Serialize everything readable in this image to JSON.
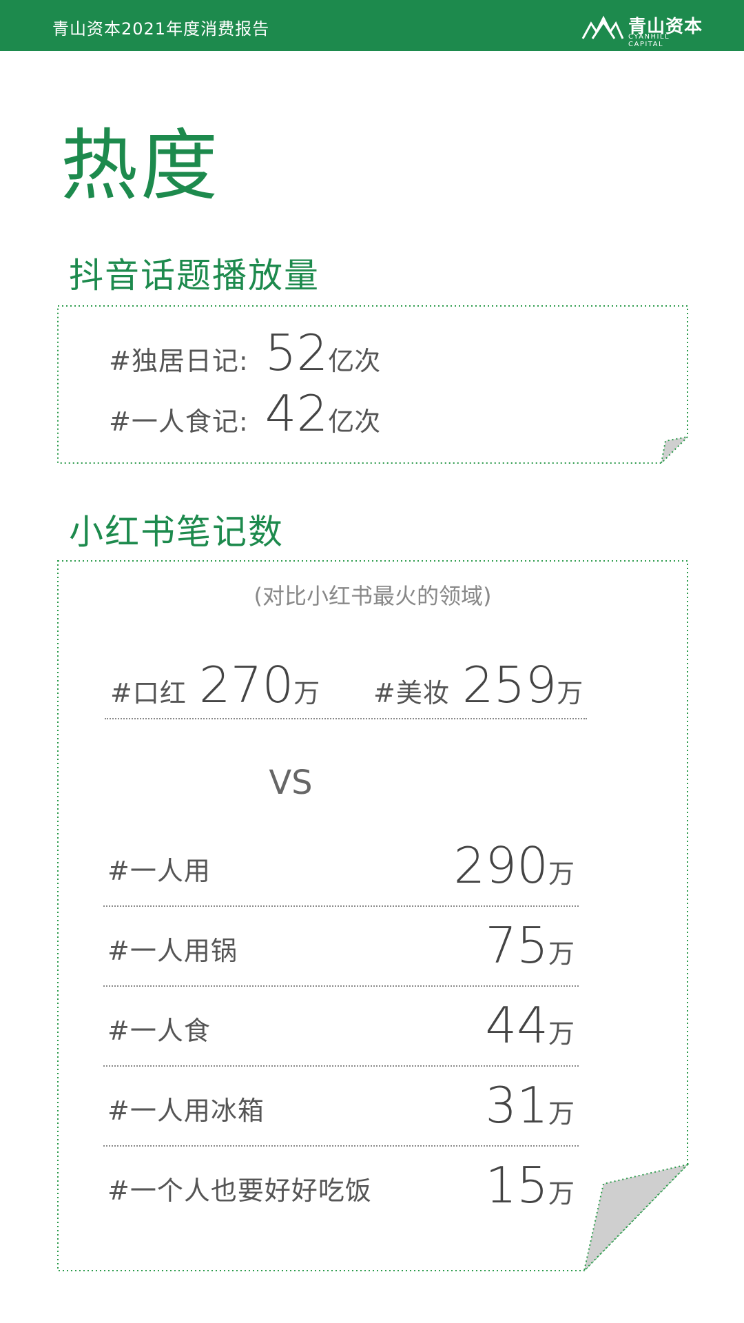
{
  "header": {
    "report_title": "青山资本2021年度消费报告",
    "logo_cn": "青山资本",
    "logo_en": "CYANHILL CAPITAL",
    "bar_color": "#1d8a4d"
  },
  "heading": "热度",
  "douyin": {
    "title": "抖音话题播放量",
    "rows": [
      {
        "tag": "#独居日记:",
        "value": "52",
        "unit": "亿次"
      },
      {
        "tag": "#一人食记:",
        "value": "42",
        "unit": "亿次"
      }
    ]
  },
  "xiaohongshu": {
    "title": "小红书笔记数",
    "note": "(对比小红书最火的领域)",
    "compare": [
      {
        "tag": "#口红",
        "value": "270",
        "unit": "万"
      },
      {
        "tag": "#美妆",
        "value": "259",
        "unit": "万"
      }
    ],
    "vs": "VS",
    "items": [
      {
        "tag": "#一人用",
        "value": "290",
        "unit": "万"
      },
      {
        "tag": "#一人用锅",
        "value": "75",
        "unit": "万"
      },
      {
        "tag": "#一人食",
        "value": "44",
        "unit": "万"
      },
      {
        "tag": "#一人用冰箱",
        "value": "31",
        "unit": "万"
      },
      {
        "tag": "#一个人也要好好吃饭",
        "value": "15",
        "unit": "万"
      }
    ]
  }
}
